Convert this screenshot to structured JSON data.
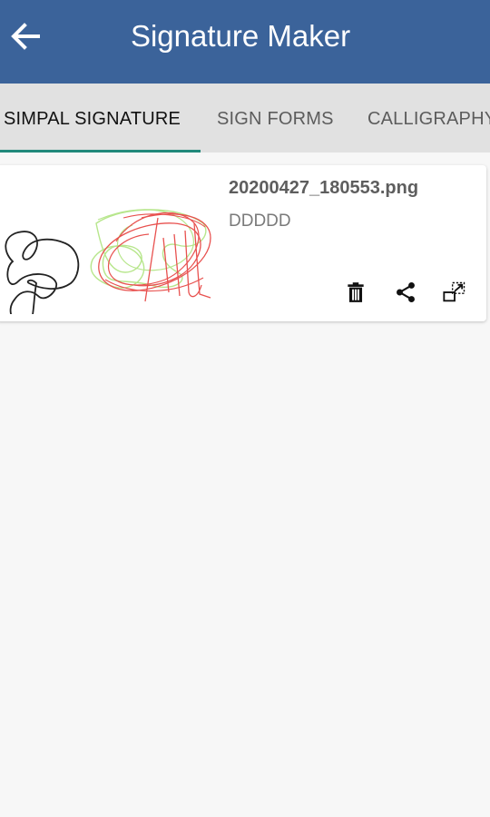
{
  "header": {
    "title": "Signature Maker",
    "back_icon": "arrow-left-icon",
    "background": "#3b639a"
  },
  "tabs": [
    {
      "label": "SIMPAL SIGNATURE",
      "active": true
    },
    {
      "label": "SIGN FORMS",
      "active": false
    },
    {
      "label": "CALLIGRAPHY",
      "active": false
    }
  ],
  "tab_indicator_color": "#21897b",
  "signatures": [
    {
      "filename": "20200427_180553.png",
      "description": "DDDDD",
      "actions": [
        "trash-icon",
        "share-icon",
        "open-external-icon"
      ]
    }
  ]
}
